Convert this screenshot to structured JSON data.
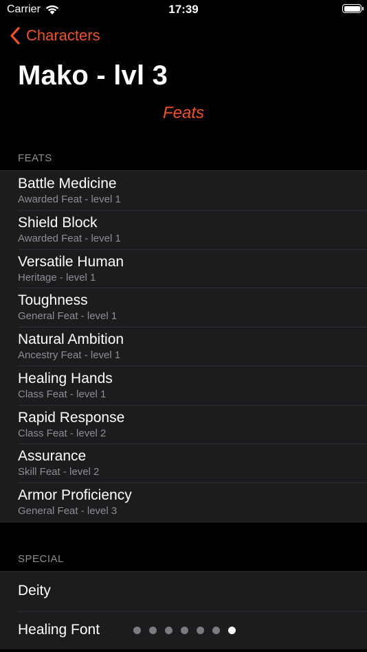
{
  "status_bar": {
    "carrier": "Carrier",
    "time": "17:39",
    "battery_level": 1.0
  },
  "nav": {
    "back_label": "Characters",
    "title": "Mako - lvl 3",
    "subtitle": "Feats"
  },
  "feats_section": {
    "header": "FEATS",
    "items": [
      {
        "name": "Battle Medicine",
        "detail": "Awarded Feat - level 1"
      },
      {
        "name": "Shield Block",
        "detail": "Awarded Feat - level 1"
      },
      {
        "name": "Versatile Human",
        "detail": "Heritage - level 1"
      },
      {
        "name": "Toughness",
        "detail": "General Feat - level 1"
      },
      {
        "name": "Natural Ambition",
        "detail": "Ancestry Feat - level 1"
      },
      {
        "name": "Healing Hands",
        "detail": "Class Feat - level 1"
      },
      {
        "name": "Rapid Response",
        "detail": "Class Feat - level 2"
      },
      {
        "name": "Assurance",
        "detail": "Skill Feat - level 2"
      },
      {
        "name": "Armor Proficiency",
        "detail": "General Feat - level 3"
      }
    ]
  },
  "special_section": {
    "header": "SPECIAL",
    "items": [
      {
        "label": "Deity"
      },
      {
        "label": "Healing Font",
        "dots_total": 7,
        "dots_active_index": 6
      }
    ]
  },
  "colors": {
    "accent": "#f4511e",
    "background": "#000000",
    "cell": "#1c1c1e",
    "secondary_text": "#8e8e93"
  }
}
